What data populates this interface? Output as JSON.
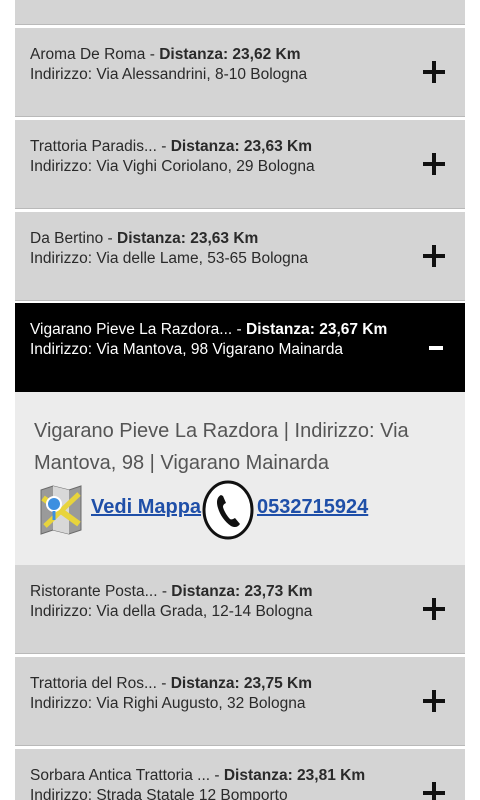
{
  "restaurants": [
    {
      "name": "Aroma De Roma",
      "distance": "Distanza: 23,62 Km",
      "address": "Indirizzo: Via Alessandrini, 8-10 Bologna"
    },
    {
      "name": "Trattoria Paradis...",
      "distance": "Distanza: 23,63 Km",
      "address": "Indirizzo: Via Vighi Coriolano, 29 Bologna"
    },
    {
      "name": "Da Bertino",
      "distance": "Distanza: 23,63 Km",
      "address": "Indirizzo: Via delle Lame, 53-65 Bologna"
    },
    {
      "name": "Vigarano Pieve La Razdora...",
      "distance": "Distanza: 23,67 Km",
      "address": "Indirizzo: Via Mantova, 98 Vigarano Mainarda"
    },
    {
      "name": "Ristorante Posta...",
      "distance": "Distanza: 23,73 Km",
      "address": "Indirizzo: Via della Grada, 12-14 Bologna"
    },
    {
      "name": "Trattoria del Ros...",
      "distance": "Distanza: 23,75 Km",
      "address": "Indirizzo: Via Righi Augusto, 32 Bologna"
    },
    {
      "name": "Sorbara Antica Trattoria ...",
      "distance": "Distanza: 23,81 Km",
      "address": "Indirizzo: Strada Statale 12 Bomporto"
    }
  ],
  "separator": " - ",
  "detail": {
    "text": "Vigarano Pieve La Razdora | Indirizzo: Via Mantova, 98 | Vigarano Mainarda",
    "map_label": " Vedi Mappa",
    "phone": " 0532715924"
  },
  "colors": {
    "row_background": "#d4d4d4",
    "expanded_row_background": "#000000",
    "detail_background": "#ececec",
    "link": "#1f4fa8"
  },
  "icons": {
    "expand": "plus-icon",
    "collapse": "minus-icon",
    "map": "map-icon",
    "phone": "phone-icon"
  }
}
